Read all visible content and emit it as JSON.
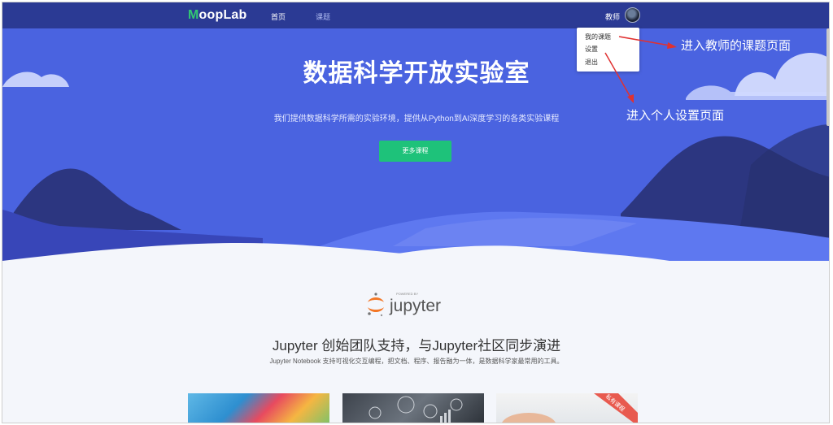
{
  "header": {
    "logo_initial": "M",
    "logo_rest": "oopLab",
    "nav": [
      "首页",
      "课题"
    ],
    "user_label": "教师"
  },
  "user_menu": {
    "items": [
      "我的课题",
      "设置",
      "退出"
    ]
  },
  "hero": {
    "title": "数据科学开放实验室",
    "subtitle": "我们提供数据科学所需的实验环境，提供从Python到AI深度学习的各类实验课程",
    "cta_label": "更多课程"
  },
  "annotations": {
    "topics_note": "进入教师的课题页面",
    "settings_note": "进入个人设置页面"
  },
  "jupyter": {
    "powered_by": "POWERED BY",
    "logo_word": "jupyter",
    "title": "Jupyter 创始团队支持，与Jupyter社区同步演进",
    "description": "Jupyter Notebook 支持可视化交互编程，把文档、程序、报告融为一体，是数据科学家最常用的工具。"
  },
  "cards": {
    "badge": "私有课程"
  },
  "colors": {
    "topbar": "#2b3a94",
    "hero": "#4a63e0",
    "accent_green": "#1ec27a",
    "annotation_arrow": "#e03131"
  }
}
